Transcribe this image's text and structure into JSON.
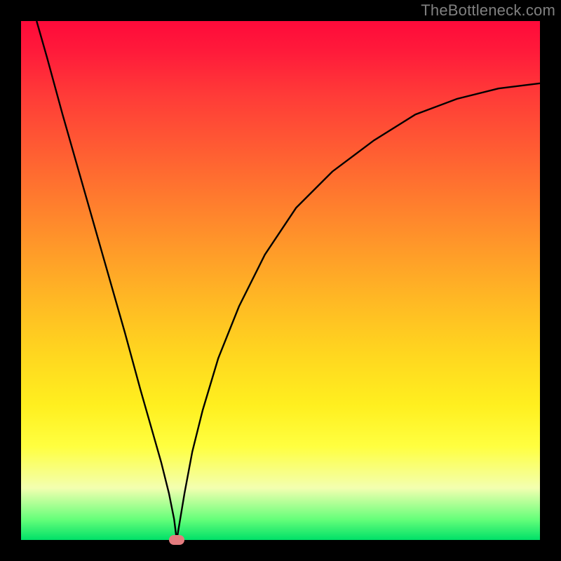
{
  "watermark": "TheBottleneck.com",
  "chart_data": {
    "type": "line",
    "title": "",
    "xlabel": "",
    "ylabel": "",
    "xlim": [
      0,
      100
    ],
    "ylim": [
      0,
      100
    ],
    "grid": false,
    "legend": false,
    "series": [
      {
        "name": "curve",
        "x": [
          3,
          5,
          8,
          12,
          16,
          20,
          23,
          25,
          27,
          28.5,
          29.5,
          30,
          30.5,
          31.5,
          33,
          35,
          38,
          42,
          47,
          53,
          60,
          68,
          76,
          84,
          92,
          100
        ],
        "y": [
          100,
          93,
          82,
          68,
          54,
          40,
          29,
          22,
          15,
          9,
          4,
          0,
          3,
          9,
          17,
          25,
          35,
          45,
          55,
          64,
          71,
          77,
          82,
          85,
          87,
          88
        ]
      }
    ],
    "marker": {
      "x": 30,
      "y": 0
    },
    "gradient_stops": [
      {
        "pct": 0,
        "color": "#ff0a3a"
      },
      {
        "pct": 14,
        "color": "#ff3a38"
      },
      {
        "pct": 34,
        "color": "#ff7a2e"
      },
      {
        "pct": 54,
        "color": "#ffb924"
      },
      {
        "pct": 74,
        "color": "#ffef1f"
      },
      {
        "pct": 90,
        "color": "#f3ffb0"
      },
      {
        "pct": 100,
        "color": "#00e068"
      }
    ]
  }
}
